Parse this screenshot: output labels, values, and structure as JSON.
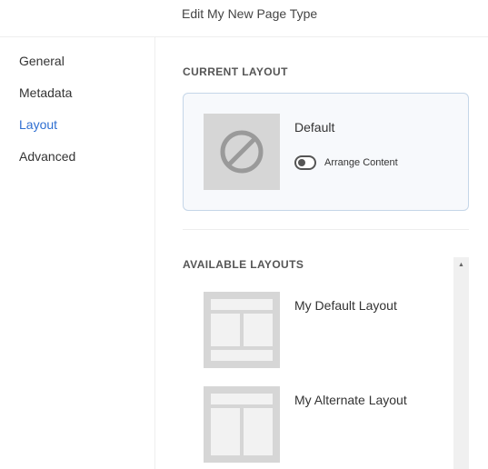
{
  "header": {
    "title": "Edit My New Page Type"
  },
  "sidebar": {
    "items": [
      {
        "label": "General"
      },
      {
        "label": "Metadata"
      },
      {
        "label": "Layout"
      },
      {
        "label": "Advanced"
      }
    ],
    "active": "Layout"
  },
  "current_layout": {
    "section_title": "CURRENT LAYOUT",
    "name": "Default",
    "icon": "no-layout-icon",
    "toggle_label": "Arrange Content",
    "toggle_on": false
  },
  "available_layouts": {
    "section_title": "AVAILABLE LAYOUTS",
    "items": [
      {
        "label": "My Default Layout",
        "icon": "header-two-column-footer-layout-icon"
      },
      {
        "label": "My Alternate Layout",
        "icon": "header-two-column-layout-icon"
      }
    ]
  },
  "colors": {
    "accent": "#2f6fd1",
    "card_border": "#c5d6e8",
    "card_bg": "#f7f9fc",
    "thumb_bg": "#d6d6d6"
  }
}
